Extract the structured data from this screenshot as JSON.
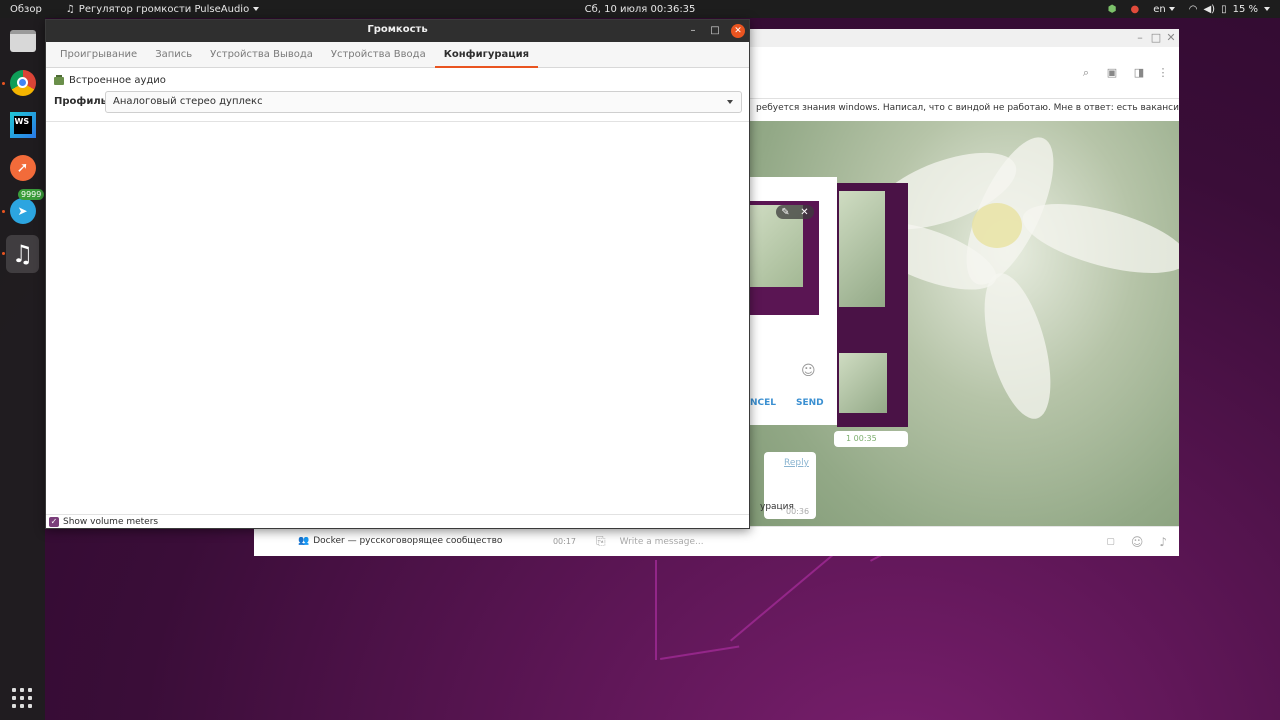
{
  "topbar": {
    "activities": "Обзор",
    "app_menu": "Регулятор громкости PulseAudio",
    "clock": "Сб, 10 июля  00:36:35",
    "keyboard_layout": "en",
    "battery": "15 %"
  },
  "dock": {
    "telegram_badge": "9999",
    "items": [
      "files-icon",
      "chrome-icon",
      "webstorm-icon",
      "postman-icon",
      "telegram-icon",
      "music-icon"
    ]
  },
  "telegram": {
    "pinned_text": "ребуется знания windows. Написал, что с виндой не работаю. Мне в ответ: есть вакансия ...",
    "chat_item": "Docker — русскоговорящее сообщество",
    "chat_item_time": "00:17",
    "message_placeholder": "Write a message...",
    "reply_label": "Reply",
    "msg_fragment": "урация",
    "msg_time": "00:36",
    "photo_meta": "1  00:35",
    "cancel_label": "NCEL",
    "send_label": "SEND"
  },
  "window": {
    "title": "Громкость",
    "tabs": [
      {
        "label": "Проигрывание"
      },
      {
        "label": "Запись"
      },
      {
        "label": "Устройства Вывода"
      },
      {
        "label": "Устройства Ввода"
      },
      {
        "label": "Конфигурация"
      }
    ],
    "active_tab": "Конфигурация",
    "card_name": "Встроенное аудио",
    "profile_label": "Профиль:",
    "profile_value": "Аналоговый стерео дуплекс",
    "show_meters_label": "Show volume meters",
    "show_meters_checked": true
  },
  "colors": {
    "accent": "#e95420",
    "titlebar": "#2f2f2f",
    "checkbox": "#7a3e7a"
  }
}
